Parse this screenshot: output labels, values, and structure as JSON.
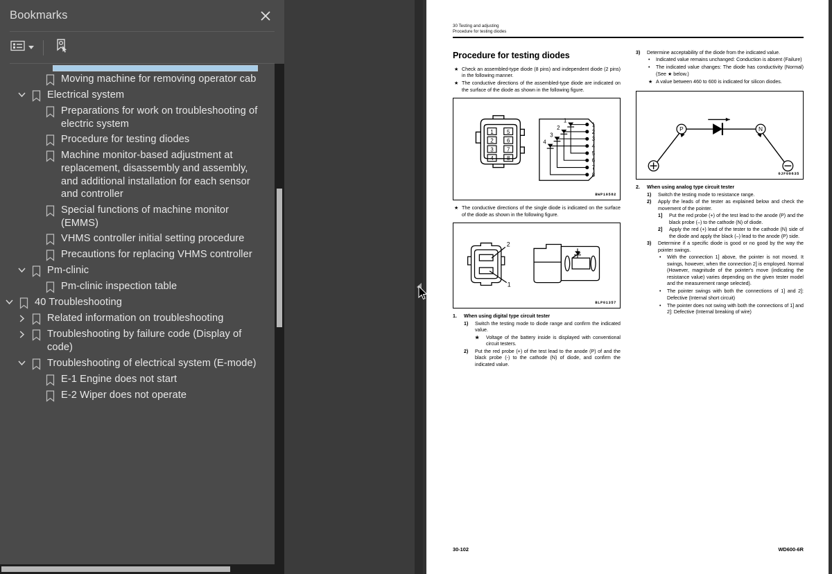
{
  "sidebar": {
    "title": "Bookmarks",
    "close_icon": "close-icon",
    "toolbar": {
      "list_view_label": "list-view-icon",
      "caret_label": "chevron-down-icon",
      "new_bookmark_label": "bookmark-pointer-icon"
    },
    "items": [
      {
        "label": "Moving machine for removing operator cab",
        "depth": 2,
        "twisty": "none"
      },
      {
        "label": "Electrical system",
        "depth": 1,
        "twisty": "expanded"
      },
      {
        "label": "Preparations for work on troubleshooting of electric system",
        "depth": 2,
        "twisty": "none"
      },
      {
        "label": "Procedure for testing diodes",
        "depth": 2,
        "twisty": "none"
      },
      {
        "label": "Machine monitor-based adjustment at replacement, disassembly and assembly, and additional installation for each sensor and controller",
        "depth": 2,
        "twisty": "none"
      },
      {
        "label": "Special functions of machine monitor (EMMS)",
        "depth": 2,
        "twisty": "none"
      },
      {
        "label": "VHMS controller initial setting procedure",
        "depth": 2,
        "twisty": "none"
      },
      {
        "label": "Precautions for replacing VHMS controller",
        "depth": 2,
        "twisty": "none"
      },
      {
        "label": "Pm-clinic",
        "depth": 1,
        "twisty": "expanded"
      },
      {
        "label": "Pm-clinic inspection table",
        "depth": 2,
        "twisty": "none"
      },
      {
        "label": "40 Troubleshooting",
        "depth": 0,
        "twisty": "expanded"
      },
      {
        "label": "Related information on troubleshooting",
        "depth": 1,
        "twisty": "collapsed"
      },
      {
        "label": "Troubleshooting by failure code (Display of code)",
        "depth": 1,
        "twisty": "collapsed"
      },
      {
        "label": "Troubleshooting of electrical system (E-mode)",
        "depth": 1,
        "twisty": "expanded"
      },
      {
        "label": "E-1 Engine does not start",
        "depth": 2,
        "twisty": "none"
      },
      {
        "label": "E-2 Wiper does not operate",
        "depth": 2,
        "twisty": "none"
      }
    ]
  },
  "document": {
    "header_line1": "30 Testing and adjusting",
    "header_line2": "Procedure for testing diodes",
    "title": "Procedure for testing diodes",
    "left_column": {
      "intro_bullets": [
        "Check an assembled-type diode (8 pins) and independent diode (2 pins) in the following manner.",
        "The conductive directions of the assembled-type diode are indicated on the surface of the diode as shown in the following figure."
      ],
      "figure1": {
        "caption": "BWP10582",
        "connector_pins_left": [
          "1",
          "2",
          "3",
          "4"
        ],
        "connector_pins_right": [
          "5",
          "6",
          "7",
          "8"
        ],
        "schematic_pins": [
          "1",
          "2",
          "3",
          "4",
          "5",
          "6",
          "7",
          "8"
        ],
        "diode_labels": [
          "1",
          "2",
          "3",
          "4"
        ]
      },
      "single_diode_bullet": "The conductive directions of the single diode is indicated on the surface of the diode as shown in the following figure.",
      "figure2": {
        "caption": "BLP01357",
        "pin_labels": [
          "2",
          "1"
        ]
      },
      "section1": {
        "number": "1.",
        "heading": "When using digital type circuit tester",
        "steps": [
          {
            "n": "1)",
            "text": "Switch the testing mode to diode range and confirm the indicated value."
          },
          {
            "n": "★",
            "text": "Voltage of the battery inside is displayed with conventional circuit testers.",
            "star": true
          },
          {
            "n": "2)",
            "text": "Put the red probe (+) of the test lead to the anode (P) of and the black probe (-) to the cathode (N) of diode, and confirm the indicated value."
          }
        ]
      }
    },
    "right_column": {
      "step3": {
        "n": "3)",
        "text": "Determine acceptability of the diode from the indicated value.",
        "bullets": [
          {
            "mark": "•",
            "text": "Indicated value remains unchanged: Conduction is absent (Failure)"
          },
          {
            "mark": "•",
            "text": "The indicated value changes: The diode has conductivity (Normal) (See ★ below.)"
          },
          {
            "mark": "★",
            "text": "A value between 460 to 600 is indicated for silicon diodes."
          }
        ]
      },
      "figure3": {
        "caption": "0JF00635",
        "node_p": "P",
        "node_n": "N",
        "terminal_plus": "+",
        "terminal_minus": "−"
      },
      "section2": {
        "number": "2.",
        "heading": "When using analog type circuit tester",
        "steps": [
          {
            "n": "1)",
            "text": "Switch the testing mode to resistance range."
          },
          {
            "n": "2)",
            "text": "Apply the leads of the tester as explained below and check the movement of the pointer."
          },
          {
            "n": "1]",
            "text": "Put the red probe (+) of the test lead to the anode (P) and the black probe (–) to the cathode (N) of diode.",
            "level": 2
          },
          {
            "n": "2]",
            "text": "Apply the red (+) lead of the tester to the cathode (N) side of the diode and apply the black (–) lead to the anode (P) side.",
            "level": 2
          },
          {
            "n": "3)",
            "text": "Determine if a specific diode is good or no good by the way the pointer swings."
          }
        ],
        "result_bullets": [
          {
            "mark": "•",
            "text": "With the connection 1] above, the pointer is not moved. It swings, however, when the connection 2] is employed. Normal (However, magnitude of the pointer's move (indicating the resistance value) varies depending on the given tester model and the measurement range selected)."
          },
          {
            "mark": "•",
            "text": "The pointer swings with both the connections of 1] and 2]: Defective (Internal short circuit)"
          },
          {
            "mark": "•",
            "text": "The pointer does not swing with both the connections of 1] and 2]: Defective (Internal breaking of wire)"
          }
        ]
      }
    },
    "footer_left": "30-102",
    "footer_right": "WD600-6R"
  },
  "colors": {
    "sidebar_bg": "#4a4a4a",
    "viewer_bg": "#323232",
    "selection": "#a8cde8",
    "scrollbar_thumb": "#b7b7b7"
  }
}
